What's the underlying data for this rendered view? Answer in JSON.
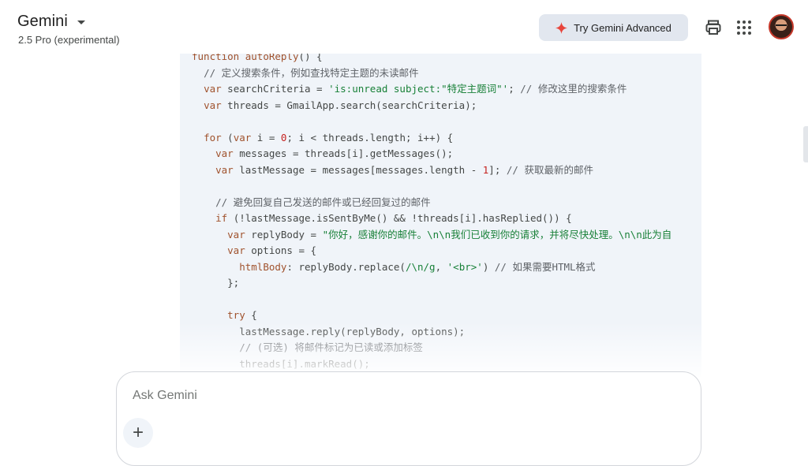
{
  "header": {
    "app_title": "Gemini",
    "model_name": "2.5 Pro (experimental)",
    "try_button_label": "Try Gemini Advanced",
    "icons": [
      "gemini-spark-icon",
      "print-icon",
      "apps-grid-icon",
      "avatar"
    ]
  },
  "code": {
    "lines": [
      "function autoReply() {",
      "  // 定义搜索条件，例如查找特定主题的未读邮件",
      "  var searchCriteria = 'is:unread subject:\"特定主题词\"'; // 修改这里的搜索条件",
      "  var threads = GmailApp.search(searchCriteria);",
      "",
      "  for (var i = 0; i < threads.length; i++) {",
      "    var messages = threads[i].getMessages();",
      "    var lastMessage = messages[messages.length - 1]; // 获取最新的邮件",
      "",
      "    // 避免回复自己发送的邮件或已经回复过的邮件",
      "    if (!lastMessage.isSentByMe() && !threads[i].hasReplied()) {",
      "      var replyBody = \"你好，感谢你的邮件。\\n\\n我们已收到你的请求，并将尽快处理。\\n\\n此为自",
      "      var options = {",
      "        htmlBody: replyBody.replace(/\\n/g, '<br>') // 如果需要HTML格式",
      "      };",
      "",
      "      try {",
      "        lastMessage.reply(replyBody, options);",
      "        // (可选) 将邮件标记为已读或添加标签",
      "        threads[i].markRead();"
    ]
  },
  "input": {
    "placeholder": "Ask Gemini",
    "value": "",
    "add_button_label": "+"
  },
  "colors": {
    "accent": "#e8453c",
    "code_bg": "#f0f4f9",
    "keyword": "#a0522d",
    "string": "#188038",
    "number": "#c5221f",
    "button_bg": "#e2e7ef"
  }
}
